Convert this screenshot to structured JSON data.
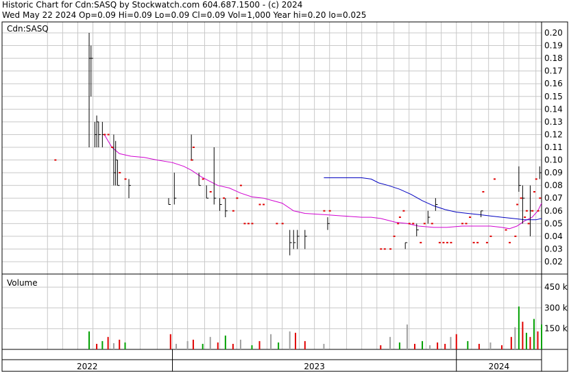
{
  "header": {
    "line1": "Historic Chart for Cdn:SASQ by Stockwatch.com 604.687.1500 - (c) 2024",
    "line2": "Wed May 22 2024   Op=0.09   Hi=0.09   Lo=0.09   Cl=0.09   Vol=1,000   Year hi=0.20   lo=0.025"
  },
  "colors": {
    "grid": "#c8c8c8",
    "price_bar": "#000000",
    "dot": "#e00000",
    "ma_short": "#d000d0",
    "ma_long": "#0000c0",
    "vol_up": "#00a000",
    "vol_down": "#e00000",
    "vol_flat": "#a0a0a0"
  },
  "chart_data": [
    {
      "type": "line",
      "title": "Cdn:SASQ",
      "y_ticks": [
        "0.20",
        "0.19",
        "0.18",
        "0.17",
        "0.16",
        "0.15",
        "0.14",
        "0.13",
        "0.12",
        "0.11",
        "0.10",
        "0.09",
        "0.08",
        "0.07",
        "0.06",
        "0.05",
        "0.04",
        "0.03",
        "0.02"
      ],
      "ylim": [
        0.01,
        0.2
      ],
      "x_labels": [
        "2022",
        "2023",
        "2024"
      ],
      "x_tick_positions": [
        2021.84,
        2021.92,
        2022.0,
        2022.08,
        2022.17,
        2022.25,
        2022.33,
        2022.42,
        2022.5,
        2022.58,
        2022.67,
        2022.75,
        2022.84,
        2022.92,
        2023.0,
        2023.08,
        2023.17,
        2023.25,
        2023.33,
        2023.42,
        2023.5,
        2023.58,
        2023.67,
        2023.75,
        2023.84,
        2023.92,
        2024.0,
        2024.08,
        2024.17,
        2024.25,
        2024.33,
        2024.42
      ],
      "x_range": [
        2021.6,
        2024.45
      ],
      "year_boundaries": [
        2022.5,
        2024.0
      ],
      "ohlc": [
        {
          "t": 2022.06,
          "lo": 0.11,
          "hi": 0.2,
          "cl": 0.18
        },
        {
          "t": 2022.07,
          "lo": 0.15,
          "hi": 0.19,
          "cl": 0.18
        },
        {
          "t": 2022.09,
          "lo": 0.11,
          "hi": 0.13,
          "cl": 0.12
        },
        {
          "t": 2022.1,
          "lo": 0.11,
          "hi": 0.135,
          "cl": 0.13
        },
        {
          "t": 2022.11,
          "lo": 0.11,
          "hi": 0.13,
          "cl": 0.12
        },
        {
          "t": 2022.13,
          "lo": 0.11,
          "hi": 0.13,
          "cl": 0.12
        },
        {
          "t": 2022.19,
          "lo": 0.08,
          "hi": 0.12,
          "cl": 0.09
        },
        {
          "t": 2022.2,
          "lo": 0.08,
          "hi": 0.115,
          "cl": 0.1
        },
        {
          "t": 2022.21,
          "lo": 0.08,
          "hi": 0.1,
          "cl": 0.08
        },
        {
          "t": 2022.27,
          "lo": 0.07,
          "hi": 0.085,
          "cl": 0.08
        },
        {
          "t": 2022.48,
          "lo": 0.065,
          "hi": 0.07,
          "cl": 0.065
        },
        {
          "t": 2022.51,
          "lo": 0.065,
          "hi": 0.09,
          "cl": 0.07
        },
        {
          "t": 2022.6,
          "lo": 0.1,
          "hi": 0.12,
          "cl": 0.1
        },
        {
          "t": 2022.64,
          "lo": 0.08,
          "hi": 0.09,
          "cl": 0.08
        },
        {
          "t": 2022.68,
          "lo": 0.07,
          "hi": 0.08,
          "cl": 0.07
        },
        {
          "t": 2022.72,
          "lo": 0.065,
          "hi": 0.11,
          "cl": 0.07
        },
        {
          "t": 2022.75,
          "lo": 0.06,
          "hi": 0.07,
          "cl": 0.065
        },
        {
          "t": 2022.78,
          "lo": 0.055,
          "hi": 0.07,
          "cl": 0.06
        },
        {
          "t": 2023.12,
          "lo": 0.025,
          "hi": 0.045,
          "cl": 0.035
        },
        {
          "t": 2023.14,
          "lo": 0.03,
          "hi": 0.045,
          "cl": 0.035
        },
        {
          "t": 2023.16,
          "lo": 0.03,
          "hi": 0.045,
          "cl": 0.04
        },
        {
          "t": 2023.2,
          "lo": 0.03,
          "hi": 0.045,
          "cl": 0.04
        },
        {
          "t": 2023.32,
          "lo": 0.045,
          "hi": 0.055,
          "cl": 0.05
        },
        {
          "t": 2023.73,
          "lo": 0.03,
          "hi": 0.035,
          "cl": 0.035
        },
        {
          "t": 2023.79,
          "lo": 0.04,
          "hi": 0.05,
          "cl": 0.045
        },
        {
          "t": 2023.85,
          "lo": 0.05,
          "hi": 0.06,
          "cl": 0.055
        },
        {
          "t": 2023.89,
          "lo": 0.06,
          "hi": 0.07,
          "cl": 0.065
        },
        {
          "t": 2024.13,
          "lo": 0.055,
          "hi": 0.06,
          "cl": 0.06
        },
        {
          "t": 2024.33,
          "lo": 0.075,
          "hi": 0.095,
          "cl": 0.08
        },
        {
          "t": 2024.35,
          "lo": 0.05,
          "hi": 0.08,
          "cl": 0.07
        },
        {
          "t": 2024.39,
          "lo": 0.04,
          "hi": 0.08,
          "cl": 0.06
        },
        {
          "t": 2024.44,
          "lo": 0.085,
          "hi": 0.095,
          "cl": 0.09
        }
      ],
      "dots": [
        {
          "t": 2021.88,
          "y": 0.1
        },
        {
          "t": 2022.14,
          "y": 0.12
        },
        {
          "t": 2022.16,
          "y": 0.12
        },
        {
          "t": 2022.18,
          "y": 0.11
        },
        {
          "t": 2022.22,
          "y": 0.09
        },
        {
          "t": 2022.25,
          "y": 0.085
        },
        {
          "t": 2022.6,
          "y": 0.1
        },
        {
          "t": 2022.61,
          "y": 0.11
        },
        {
          "t": 2022.66,
          "y": 0.085
        },
        {
          "t": 2022.7,
          "y": 0.075
        },
        {
          "t": 2022.77,
          "y": 0.07
        },
        {
          "t": 2022.82,
          "y": 0.06
        },
        {
          "t": 2022.84,
          "y": 0.07
        },
        {
          "t": 2022.86,
          "y": 0.08
        },
        {
          "t": 2022.88,
          "y": 0.05
        },
        {
          "t": 2022.9,
          "y": 0.05
        },
        {
          "t": 2022.92,
          "y": 0.05
        },
        {
          "t": 2022.96,
          "y": 0.065
        },
        {
          "t": 2022.98,
          "y": 0.065
        },
        {
          "t": 2023.05,
          "y": 0.05
        },
        {
          "t": 2023.08,
          "y": 0.05
        },
        {
          "t": 2023.3,
          "y": 0.06
        },
        {
          "t": 2023.33,
          "y": 0.06
        },
        {
          "t": 2023.6,
          "y": 0.03
        },
        {
          "t": 2023.62,
          "y": 0.03
        },
        {
          "t": 2023.65,
          "y": 0.03
        },
        {
          "t": 2023.67,
          "y": 0.04
        },
        {
          "t": 2023.69,
          "y": 0.05
        },
        {
          "t": 2023.7,
          "y": 0.055
        },
        {
          "t": 2023.72,
          "y": 0.06
        },
        {
          "t": 2023.75,
          "y": 0.05
        },
        {
          "t": 2023.77,
          "y": 0.05
        },
        {
          "t": 2023.81,
          "y": 0.035
        },
        {
          "t": 2023.83,
          "y": 0.05
        },
        {
          "t": 2023.87,
          "y": 0.05
        },
        {
          "t": 2023.91,
          "y": 0.035
        },
        {
          "t": 2023.93,
          "y": 0.035
        },
        {
          "t": 2023.95,
          "y": 0.035
        },
        {
          "t": 2023.97,
          "y": 0.035
        },
        {
          "t": 2024.03,
          "y": 0.05
        },
        {
          "t": 2024.05,
          "y": 0.05
        },
        {
          "t": 2024.07,
          "y": 0.055
        },
        {
          "t": 2024.09,
          "y": 0.035
        },
        {
          "t": 2024.11,
          "y": 0.035
        },
        {
          "t": 2024.14,
          "y": 0.075
        },
        {
          "t": 2024.16,
          "y": 0.035
        },
        {
          "t": 2024.18,
          "y": 0.04
        },
        {
          "t": 2024.2,
          "y": 0.085
        },
        {
          "t": 2024.26,
          "y": 0.045
        },
        {
          "t": 2024.28,
          "y": 0.035
        },
        {
          "t": 2024.31,
          "y": 0.04
        },
        {
          "t": 2024.32,
          "y": 0.065
        },
        {
          "t": 2024.34,
          "y": 0.07
        },
        {
          "t": 2024.36,
          "y": 0.055
        },
        {
          "t": 2024.37,
          "y": 0.06
        },
        {
          "t": 2024.38,
          "y": 0.05
        },
        {
          "t": 2024.4,
          "y": 0.06
        },
        {
          "t": 2024.41,
          "y": 0.075
        },
        {
          "t": 2024.42,
          "y": 0.085
        },
        {
          "t": 2024.43,
          "y": 0.06
        },
        {
          "t": 2024.44,
          "y": 0.07
        }
      ],
      "series": [
        {
          "key": "ma_short",
          "points": [
            [
              2022.14,
              0.12
            ],
            [
              2022.18,
              0.11
            ],
            [
              2022.22,
              0.105
            ],
            [
              2022.28,
              0.103
            ],
            [
              2022.35,
              0.102
            ],
            [
              2022.42,
              0.1
            ],
            [
              2022.5,
              0.098
            ],
            [
              2022.56,
              0.095
            ],
            [
              2022.6,
              0.092
            ],
            [
              2022.65,
              0.087
            ],
            [
              2022.7,
              0.083
            ],
            [
              2022.74,
              0.08
            ],
            [
              2022.8,
              0.078
            ],
            [
              2022.86,
              0.074
            ],
            [
              2022.92,
              0.071
            ],
            [
              2022.98,
              0.07
            ],
            [
              2023.03,
              0.068
            ],
            [
              2023.08,
              0.066
            ],
            [
              2023.14,
              0.06
            ],
            [
              2023.2,
              0.058
            ],
            [
              2023.3,
              0.057
            ],
            [
              2023.4,
              0.056
            ],
            [
              2023.5,
              0.055
            ],
            [
              2023.55,
              0.055
            ],
            [
              2023.6,
              0.054
            ],
            [
              2023.68,
              0.051
            ],
            [
              2023.74,
              0.05
            ],
            [
              2023.8,
              0.048
            ],
            [
              2023.88,
              0.047
            ],
            [
              2023.95,
              0.047
            ],
            [
              2024.03,
              0.048
            ],
            [
              2024.1,
              0.048
            ],
            [
              2024.18,
              0.048
            ],
            [
              2024.24,
              0.047
            ],
            [
              2024.28,
              0.046
            ],
            [
              2024.32,
              0.048
            ],
            [
              2024.36,
              0.052
            ],
            [
              2024.4,
              0.055
            ],
            [
              2024.43,
              0.06
            ],
            [
              2024.45,
              0.066
            ]
          ]
        },
        {
          "key": "ma_long",
          "points": [
            [
              2023.3,
              0.086
            ],
            [
              2023.36,
              0.086
            ],
            [
              2023.42,
              0.086
            ],
            [
              2023.5,
              0.086
            ],
            [
              2023.55,
              0.085
            ],
            [
              2023.59,
              0.082
            ],
            [
              2023.64,
              0.08
            ],
            [
              2023.7,
              0.077
            ],
            [
              2023.76,
              0.073
            ],
            [
              2023.82,
              0.068
            ],
            [
              2023.88,
              0.064
            ],
            [
              2023.94,
              0.061
            ],
            [
              2024.0,
              0.059
            ],
            [
              2024.06,
              0.058
            ],
            [
              2024.12,
              0.057
            ],
            [
              2024.18,
              0.056
            ],
            [
              2024.24,
              0.055
            ],
            [
              2024.3,
              0.054
            ],
            [
              2024.36,
              0.053
            ],
            [
              2024.42,
              0.053
            ],
            [
              2024.45,
              0.054
            ]
          ]
        }
      ]
    },
    {
      "type": "bar",
      "title": "Volume",
      "y_ticks": [
        "450 k",
        "300 k",
        "150 k"
      ],
      "y_tick_values": [
        450000,
        300000,
        150000
      ],
      "ylim": [
        0,
        520000
      ],
      "bars": [
        {
          "t": 2022.06,
          "v": 130000,
          "c": "up"
        },
        {
          "t": 2022.1,
          "v": 40000,
          "c": "down"
        },
        {
          "t": 2022.13,
          "v": 60000,
          "c": "up"
        },
        {
          "t": 2022.16,
          "v": 90000,
          "c": "down"
        },
        {
          "t": 2022.19,
          "v": 45000,
          "c": "flat"
        },
        {
          "t": 2022.22,
          "v": 70000,
          "c": "down"
        },
        {
          "t": 2022.25,
          "v": 50000,
          "c": "up"
        },
        {
          "t": 2022.49,
          "v": 110000,
          "c": "down"
        },
        {
          "t": 2022.52,
          "v": 40000,
          "c": "flat"
        },
        {
          "t": 2022.58,
          "v": 60000,
          "c": "flat"
        },
        {
          "t": 2022.61,
          "v": 70000,
          "c": "down"
        },
        {
          "t": 2022.66,
          "v": 40000,
          "c": "up"
        },
        {
          "t": 2022.7,
          "v": 90000,
          "c": "flat"
        },
        {
          "t": 2022.74,
          "v": 50000,
          "c": "down"
        },
        {
          "t": 2022.78,
          "v": 100000,
          "c": "up"
        },
        {
          "t": 2022.82,
          "v": 40000,
          "c": "down"
        },
        {
          "t": 2022.86,
          "v": 70000,
          "c": "flat"
        },
        {
          "t": 2022.92,
          "v": 30000,
          "c": "up"
        },
        {
          "t": 2022.96,
          "v": 60000,
          "c": "down"
        },
        {
          "t": 2023.02,
          "v": 110000,
          "c": "flat"
        },
        {
          "t": 2023.06,
          "v": 50000,
          "c": "up"
        },
        {
          "t": 2023.12,
          "v": 130000,
          "c": "flat"
        },
        {
          "t": 2023.15,
          "v": 120000,
          "c": "down"
        },
        {
          "t": 2023.2,
          "v": 60000,
          "c": "down"
        },
        {
          "t": 2023.3,
          "v": 40000,
          "c": "flat"
        },
        {
          "t": 2023.6,
          "v": 30000,
          "c": "down"
        },
        {
          "t": 2023.65,
          "v": 90000,
          "c": "flat"
        },
        {
          "t": 2023.7,
          "v": 50000,
          "c": "up"
        },
        {
          "t": 2023.74,
          "v": 180000,
          "c": "flat"
        },
        {
          "t": 2023.78,
          "v": 40000,
          "c": "down"
        },
        {
          "t": 2023.82,
          "v": 60000,
          "c": "up"
        },
        {
          "t": 2023.86,
          "v": 30000,
          "c": "flat"
        },
        {
          "t": 2023.9,
          "v": 50000,
          "c": "down"
        },
        {
          "t": 2023.94,
          "v": 40000,
          "c": "down"
        },
        {
          "t": 2023.97,
          "v": 90000,
          "c": "flat"
        },
        {
          "t": 2024.0,
          "v": 110000,
          "c": "down"
        },
        {
          "t": 2024.06,
          "v": 60000,
          "c": "up"
        },
        {
          "t": 2024.12,
          "v": 40000,
          "c": "down"
        },
        {
          "t": 2024.18,
          "v": 50000,
          "c": "flat"
        },
        {
          "t": 2024.24,
          "v": 30000,
          "c": "down"
        },
        {
          "t": 2024.29,
          "v": 90000,
          "c": "down"
        },
        {
          "t": 2024.31,
          "v": 160000,
          "c": "flat"
        },
        {
          "t": 2024.33,
          "v": 310000,
          "c": "up"
        },
        {
          "t": 2024.35,
          "v": 200000,
          "c": "down"
        },
        {
          "t": 2024.37,
          "v": 120000,
          "c": "up"
        },
        {
          "t": 2024.39,
          "v": 90000,
          "c": "down"
        },
        {
          "t": 2024.41,
          "v": 220000,
          "c": "up"
        },
        {
          "t": 2024.43,
          "v": 130000,
          "c": "down"
        },
        {
          "t": 2024.45,
          "v": 180000,
          "c": "up"
        }
      ]
    }
  ]
}
